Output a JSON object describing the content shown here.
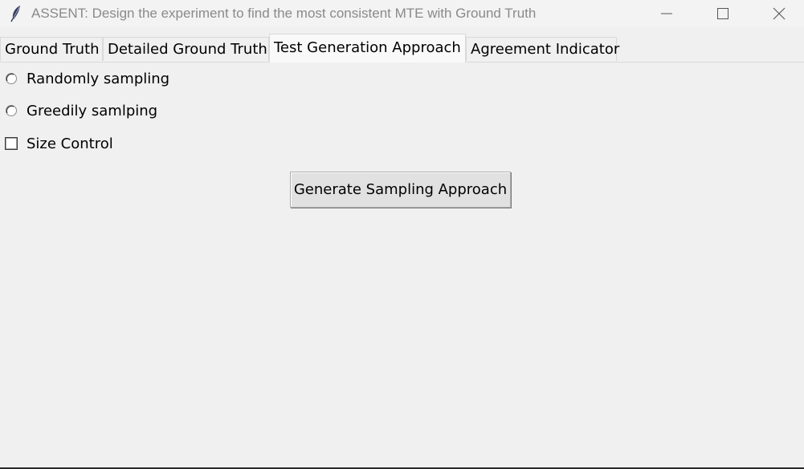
{
  "window": {
    "title": "ASSENT: Design the experiment to find the most consistent MTE with Ground Truth",
    "icon": "feather-icon"
  },
  "tabs": [
    {
      "label": "Ground Truth",
      "active": false
    },
    {
      "label": "Detailed Ground Truth",
      "active": false
    },
    {
      "label": "Test Generation Approach",
      "active": true
    },
    {
      "label": "Agreement Indicator",
      "active": false
    }
  ],
  "options": {
    "random_label": "Randomly sampling",
    "greedy_label": "Greedily samlping",
    "size_control_label": "Size Control",
    "random_selected": false,
    "greedy_selected": false,
    "size_control_checked": false
  },
  "actions": {
    "generate_label": "Generate Sampling Approach"
  }
}
